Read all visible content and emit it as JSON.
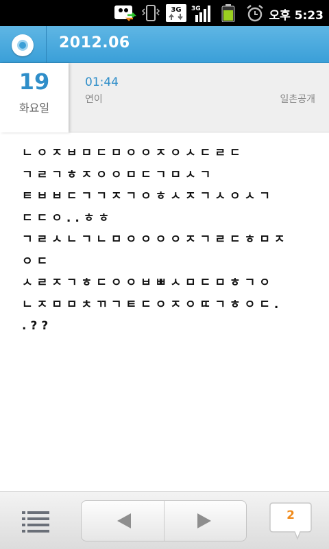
{
  "status_bar": {
    "time": "오후 5:23",
    "icons": [
      "media-sync-icon",
      "vibrate-icon",
      "3g-data-icon",
      "3g-signal-icon",
      "battery-icon",
      "alarm-icon"
    ],
    "network_label": "3G"
  },
  "header": {
    "app_icon": "diary-app-icon",
    "title": "2012.06"
  },
  "entry": {
    "day": "19",
    "weekday": "화요일",
    "time": "01:44",
    "author": "연이",
    "privacy": "일촌공개",
    "lines": [
      "ㄴㅇㅈㅂㅁㄷㅁㅇㅇㅈㅇㅅㄷㄹㄷ",
      "ㄱㄹㄱㅎㅈㅇㅇㅁㄷㄱㅁㅅㄱ",
      "ㅌㅂㅂㄷㄱㄱㅈㄱㅇㅎㅅㅈㄱㅅㅇㅅㄱ",
      "ㄷㄷㅇ..ㅎㅎ",
      "ㄱㄹㅅㄴㄱㄴㅁㅇㅇㅇㅇㅈㄱㄹㄷㅎㅁㅈ",
      "ㅇㄷ",
      "ㅅㄹㅈㄱㅎㄷㅇㅇㅂㅃㅅㅁㄷㅁㅎㄱㅇ",
      "ㄴㅈㅁㅁㅊㄲㄱㅌㄷㅇㅈㅇㄸㄱㅎㅇㄷ.",
      ".??"
    ]
  },
  "bottom_bar": {
    "menu_icon": "list-menu-icon",
    "prev_icon": "arrow-left-icon",
    "next_icon": "arrow-right-icon",
    "comment_count": "2"
  },
  "colors": {
    "title_bar": "#3a9fd8",
    "accent_blue": "#2f8ec9",
    "comment_orange": "#f08a1a",
    "status_bar": "#000000"
  }
}
